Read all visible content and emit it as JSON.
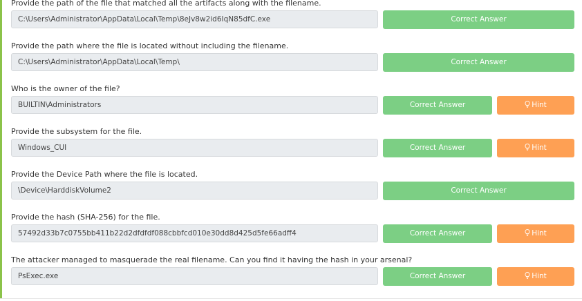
{
  "questions": [
    {
      "label": "Provide the path of the file that matched all the artifacts along with the filename.",
      "answer": "C:\\Users\\Administrator\\AppData\\Local\\Temp\\8eJv8w2id6IqN85dfC.exe",
      "button": "Correct Answer",
      "hint": null
    },
    {
      "label": "Provide the path where the file is located without including the filename.",
      "answer": "C:\\Users\\Administrator\\AppData\\Local\\Temp\\",
      "button": "Correct Answer",
      "hint": null
    },
    {
      "label": "Who is the owner of the file?",
      "answer": "BUILTIN\\Administrators",
      "button": "Correct Answer",
      "hint": "Hint"
    },
    {
      "label": "Provide the subsystem for the file.",
      "answer": "Windows_CUI",
      "button": "Correct Answer",
      "hint": "Hint"
    },
    {
      "label": "Provide the Device Path where the file is located.",
      "answer": "\\Device\\HarddiskVolume2",
      "button": "Correct Answer",
      "hint": null
    },
    {
      "label": "Provide the hash (SHA-256) for the file.",
      "answer": "57492d33b7c0755bb411b22d2dfdfdf088cbbfcd010e30dd8d425d5fe66adff4",
      "button": "Correct Answer",
      "hint": "Hint"
    },
    {
      "label": "The attacker managed to masquerade the real filename. Can you find it having the hash in your arsenal?",
      "answer": "PsExec.exe",
      "button": "Correct Answer",
      "hint": "Hint"
    }
  ],
  "colors": {
    "accent_border": "#8bc34a",
    "correct_button": "#7ccf84",
    "hint_button": "#fea054",
    "input_background": "#e9ecef"
  },
  "icons": {
    "hint": "lightbulb-icon"
  }
}
